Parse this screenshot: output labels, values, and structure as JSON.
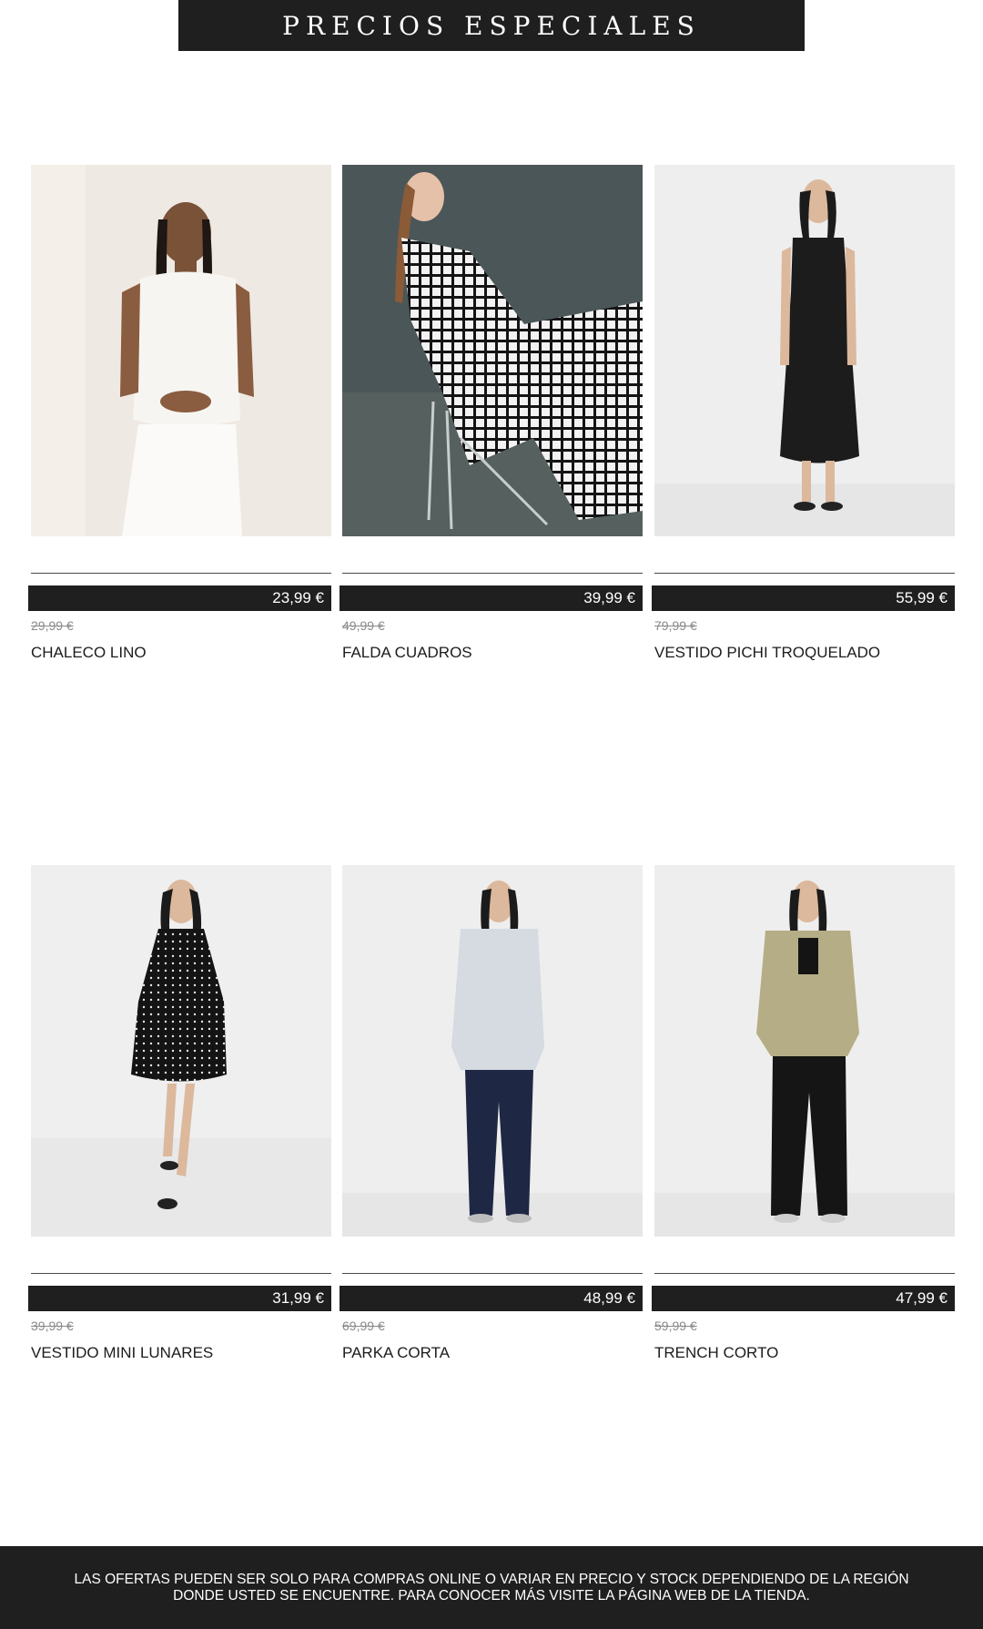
{
  "header": {
    "title": "PRECIOS ESPECIALES"
  },
  "products": [
    {
      "name": "CHALECO LINO",
      "price": "23,99 €",
      "old_price": "29,99 €",
      "image": "white-linen-vest-photo"
    },
    {
      "name": "FALDA CUADROS",
      "price": "39,99 €",
      "old_price": "49,99 €",
      "image": "checked-skirt-photo"
    },
    {
      "name": "VESTIDO PICHI TROQUELADO",
      "price": "55,99 €",
      "old_price": "79,99 €",
      "image": "black-pinafore-dress-photo"
    },
    {
      "name": "VESTIDO MINI LUNARES",
      "price": "31,99 €",
      "old_price": "39,99 €",
      "image": "polka-dot-mini-dress-photo"
    },
    {
      "name": "PARKA CORTA",
      "price": "48,99 €",
      "old_price": "69,99 €",
      "image": "short-parka-photo"
    },
    {
      "name": "TRENCH CORTO",
      "price": "47,99 €",
      "old_price": "59,99 €",
      "image": "short-trench-photo"
    }
  ],
  "footer": {
    "line1": "LAS OFERTAS PUEDEN SER SOLO PARA COMPRAS ONLINE O VARIAR EN PRECIO Y STOCK DEPENDIENDO DE LA REGIÓN",
    "line2": "DONDE USTED SE ENCUENTRE. PARA CONOCER MÁS VISITE LA PÁGINA WEB DE LA TIENDA."
  },
  "colors": {
    "banner_bg": "#1f1f1f",
    "text": "#1c1c1c",
    "old_price": "#8a8a8a"
  }
}
